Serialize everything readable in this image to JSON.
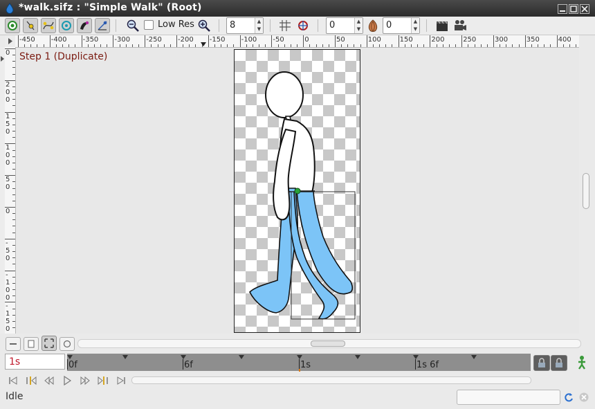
{
  "window": {
    "title": "*walk.sifz : \"Simple Walk\" (Root)",
    "buttons": [
      "minimize",
      "maximize",
      "close"
    ]
  },
  "toolbar": {
    "tools": [
      {
        "name": "render-origin-icon",
        "active": true
      },
      {
        "name": "position-ducks-icon",
        "active": true
      },
      {
        "name": "vertex-ducks-icon",
        "active": true
      },
      {
        "name": "radius-ducks-icon",
        "active": true
      },
      {
        "name": "width-ducks-icon",
        "active": true
      },
      {
        "name": "angle-ducks-icon",
        "active": true
      }
    ],
    "low_res_label": "Low Res",
    "low_res_checked": false,
    "resolution_value": "8",
    "onion_past_value": "0",
    "onion_future_value": "0"
  },
  "ruler": {
    "h_labels": [
      "-450",
      "-400",
      "-350",
      "-300",
      "-250",
      "-200",
      "-150",
      "-100",
      "-50",
      "0",
      "50",
      "100",
      "150",
      "200",
      "250",
      "300",
      "350",
      "400"
    ],
    "v_labels": [
      "0",
      "2\n0\n0",
      "1\n5\n0",
      "1\n0\n0",
      "5\n0",
      "0",
      "-\n5\n0",
      "-\n1\n0\n0",
      "-\n1\n5\n0",
      "-\n2"
    ]
  },
  "canvas": {
    "layer_label": "Step 1 (Duplicate)"
  },
  "timebar": {
    "current_time": "1s",
    "labels": [
      "0f",
      "6f",
      "1s",
      "1s 6f"
    ]
  },
  "status": {
    "text": "Idle"
  },
  "colors": {
    "pants": "#7cc4f7",
    "body": "#ffffff",
    "outline": "#111111",
    "time_red": "#c0182b",
    "layer_label": "#7a1a10"
  }
}
